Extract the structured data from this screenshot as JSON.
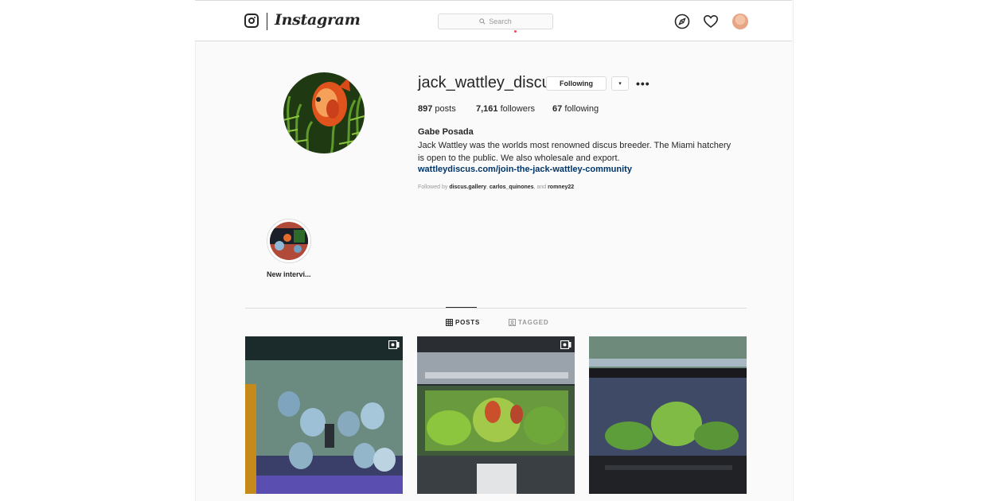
{
  "header": {
    "logo_text": "Instagram",
    "search_placeholder": "Search",
    "icons": [
      "instagram-glyph-icon",
      "search-icon",
      "explore-compass-icon",
      "heart-icon",
      "profile-avatar"
    ]
  },
  "profile": {
    "username": "jack_wattley_discus",
    "following_button": "Following",
    "dropdown_caret": "▾",
    "more_options": "•••",
    "stats": {
      "posts_count": "897",
      "posts_label": "posts",
      "followers_count": "7,161",
      "followers_label": "followers",
      "following_count": "67",
      "following_label": "following"
    },
    "full_name": "Gabe Posada",
    "bio": "Jack Wattley was the worlds most renowned discus breeder. The Miami hatchery is open to the public. We also wholesale and export.",
    "link": "wattleydiscus.com/join-the-jack-wattley-community",
    "followed_by_prefix": "Followed by",
    "followed_by_users": [
      "discus.gallery",
      "carlos_quinones",
      "romney22"
    ],
    "followed_by_and": "and"
  },
  "highlights": [
    {
      "label": "New intervi..."
    }
  ],
  "tabs": [
    {
      "label": "POSTS",
      "active": true
    },
    {
      "label": "TAGGED",
      "active": false
    }
  ],
  "posts": [
    {
      "type": "video"
    },
    {
      "type": "video"
    },
    {
      "type": "photo"
    }
  ],
  "colors": {
    "link": "#003569",
    "border": "#dbdbdb",
    "background": "#fafafa",
    "text": "#262626",
    "muted": "#999999",
    "notification": "#ed4956"
  }
}
